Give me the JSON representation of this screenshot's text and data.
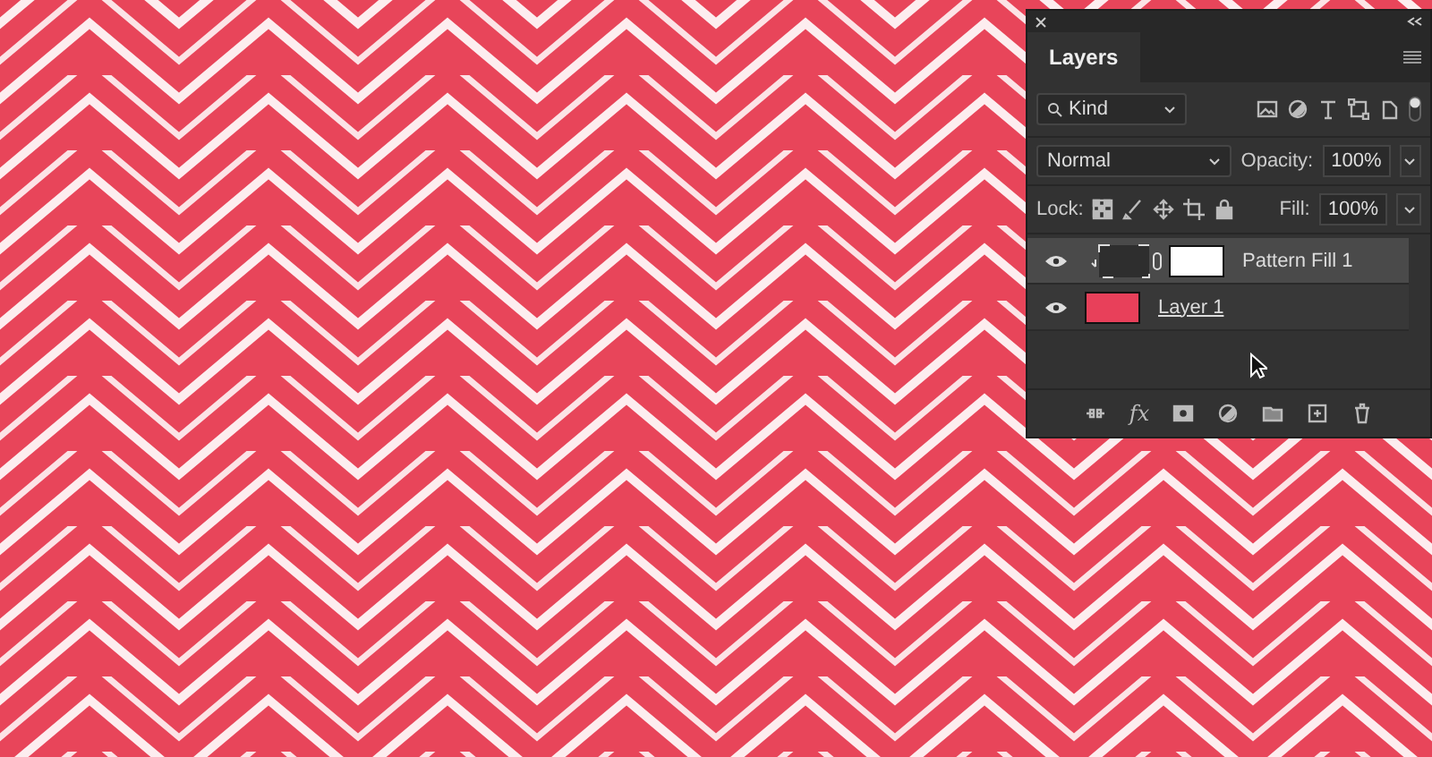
{
  "panel": {
    "title": "Layers",
    "filter": "Kind",
    "blend_mode": "Normal",
    "opacity_label": "Opacity:",
    "opacity": "100%",
    "lock_label": "Lock:",
    "fill_label": "Fill:",
    "fill": "100%",
    "effects_button": "fx"
  },
  "layers": [
    {
      "name": "Pattern Fill 1",
      "kind": "fill",
      "visible": true,
      "selected": true
    },
    {
      "name": "Layer 1",
      "kind": "pixel",
      "visible": true,
      "selected": false,
      "color": "#e8405a"
    }
  ]
}
